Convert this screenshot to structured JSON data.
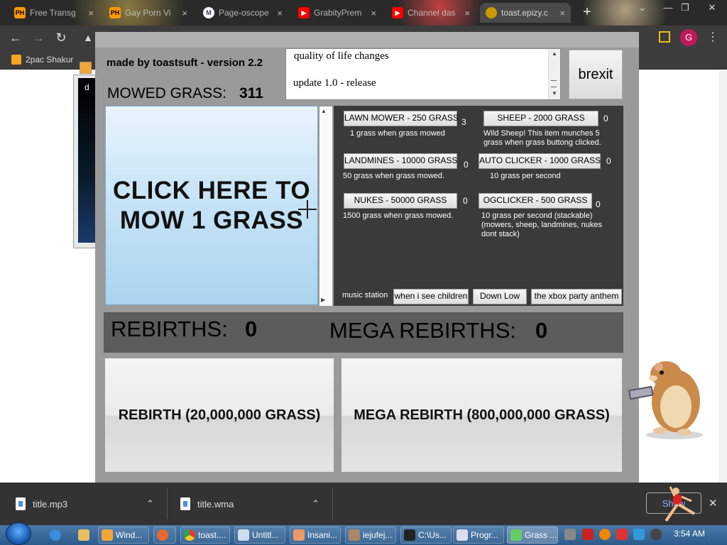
{
  "browser": {
    "tabs": [
      {
        "favicon": "PH",
        "title": "Free Transg"
      },
      {
        "favicon": "PH",
        "title": "Gay Porn Vi"
      },
      {
        "favicon": "M",
        "title": "Page-oscope"
      },
      {
        "favicon": "▶",
        "title": "GrabityPrem"
      },
      {
        "favicon": "▶",
        "title": "Channel das"
      },
      {
        "favicon": "",
        "title": "toast.epizy.c"
      }
    ],
    "tab_close": "×",
    "new_tab": "+",
    "window_controls": {
      "dropdown": "⌄",
      "minimize": "—",
      "restore": "❐",
      "close": "✕"
    },
    "profile_initial": "G",
    "bookmark": "2pac Shakur",
    "bg_window_letter": "d",
    "nav_icons": {
      "back": "←",
      "forward": "→",
      "reload": "↻",
      "warning": "▲",
      "menu": "⋮"
    }
  },
  "game": {
    "credit": "made by toastsuft - version 2.2",
    "mowed_label": "MOWED GRASS:",
    "mowed_value": "311",
    "changelog": [
      "quality of life changes",
      "update 1.0 - release"
    ],
    "brexit_label": "brexit",
    "mow_button": "CLICK HERE TO MOW 1 GRASS",
    "shop": [
      {
        "label": "LAWN MOWER - 250 GRASS",
        "count": "3",
        "desc": "1 grass when grass mowed"
      },
      {
        "label": "SHEEP - 2000 GRASS",
        "count": "0",
        "desc": "Wild Sheep! This item munches 5 grass when grass buttong clicked."
      },
      {
        "label": "LANDMINES - 10000 GRASS",
        "count": "0",
        "desc": "50 grass when grass mowed."
      },
      {
        "label": "AUTO CLICKER - 1000 GRASS",
        "count": "0",
        "desc": "10 grass per second"
      },
      {
        "label": "NUKES - 50000 GRASS",
        "count": "0",
        "desc": "1500 grass when grass mowed."
      },
      {
        "label": "OGCLICKER - 500 GRASS",
        "count": "0",
        "desc": "10 grass per second (stackable) (mowers, sheep, landmines, nukes dont stack)"
      }
    ],
    "music_label": "music station",
    "music_buttons": [
      "when i see children",
      "Down Low",
      "the xbox party anthem"
    ],
    "rebirths_label": "REBIRTHS:",
    "rebirths_value": "0",
    "mega_label": "MEGA REBIRTHS:",
    "mega_value": "0",
    "rebirth_button": "REBIRTH (20,000,000 GRASS)",
    "mega_button": "MEGA REBIRTH (800,000,000 GRASS)"
  },
  "downloads": {
    "items": [
      "title.mp3",
      "title.wma"
    ],
    "chevron": "⌃",
    "show_all": "Show",
    "close": "✕"
  },
  "taskbar": {
    "items": [
      "Wind...",
      "",
      "toast....",
      "Untitl...",
      "Insani...",
      "iejufej...",
      "C:\\Us...",
      "Progr...",
      "Grass ..."
    ],
    "clock": "3:54 AM"
  }
}
